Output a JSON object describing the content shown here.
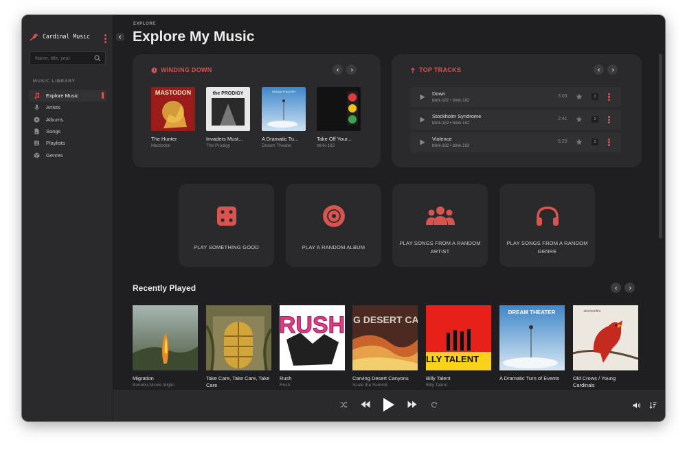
{
  "app": {
    "name": "Cardinal Music"
  },
  "search": {
    "placeholder": "Name, title, year"
  },
  "sidebar": {
    "heading": "MUSIC LIBRARY",
    "items": [
      {
        "label": "Explore Music",
        "icon": "music-note-icon",
        "active": true
      },
      {
        "label": "Artists",
        "icon": "microphone-icon"
      },
      {
        "label": "Albums",
        "icon": "disc-icon"
      },
      {
        "label": "Songs",
        "icon": "file-music-icon"
      },
      {
        "label": "Playlists",
        "icon": "list-icon"
      },
      {
        "label": "Genres",
        "icon": "box-icon"
      }
    ]
  },
  "page": {
    "breadcrumb": "EXPLORE",
    "title": "Explore My Music"
  },
  "winding_down": {
    "title": "WINDING DOWN",
    "albums": [
      {
        "title": "The Hunter",
        "artist": "Mastodon"
      },
      {
        "title": "Invaders Must...",
        "artist": "The Prodigy"
      },
      {
        "title": "A Dramatic Tu...",
        "artist": "Dream Theater"
      },
      {
        "title": "Take Off Your...",
        "artist": "blink-182"
      }
    ]
  },
  "top_tracks": {
    "title": "TOP TRACKS",
    "tracks": [
      {
        "name": "Down",
        "artists": "blink-182 • blink-182",
        "duration": "3:03",
        "plays": "2"
      },
      {
        "name": "Stockholm Syndrome",
        "artists": "blink-182 • blink-182",
        "duration": "2:41",
        "plays": "2"
      },
      {
        "name": "Violence",
        "artists": "blink-182 • blink-182",
        "duration": "5:20",
        "plays": "2"
      }
    ]
  },
  "actions": [
    {
      "label": "PLAY SOMETHING GOOD",
      "icon": "dice-icon"
    },
    {
      "label": "PLAY A RANDOM ALBUM",
      "icon": "record-icon"
    },
    {
      "label": "PLAY SONGS FROM A RANDOM ARTIST",
      "icon": "users-icon"
    },
    {
      "label": "PLAY SONGS FROM A RANDOM GENRE",
      "icon": "headphones-icon"
    }
  ],
  "recently_played": {
    "title": "Recently Played",
    "albums": [
      {
        "title": "Migration",
        "artist": "Bonobo,Nicole Miglis"
      },
      {
        "title": "Take Care, Take Care, Take Care",
        "artist": ""
      },
      {
        "title": "Rush",
        "artist": "Rush"
      },
      {
        "title": "Carving Desert Canyons",
        "artist": "Scale the Summit"
      },
      {
        "title": "Billy Talent",
        "artist": "Billy Talent"
      },
      {
        "title": "A Dramatic Turn of Events",
        "artist": ""
      },
      {
        "title": "Old Crows / Young Cardinals",
        "artist": ""
      }
    ]
  },
  "cover_text": {
    "mastodon": "MASTODON",
    "prodigy": "the PRODIGY",
    "rush": "RUSH",
    "carving": "CARVING DESERT CANYONS",
    "billy": "BILLY TALENT",
    "dream": "DREAM THEATER",
    "alexisonfire": "alexisonfire"
  },
  "colors": {
    "accent": "#d9534f",
    "background": "#1f1f21",
    "panel": "#2a2a2c"
  }
}
